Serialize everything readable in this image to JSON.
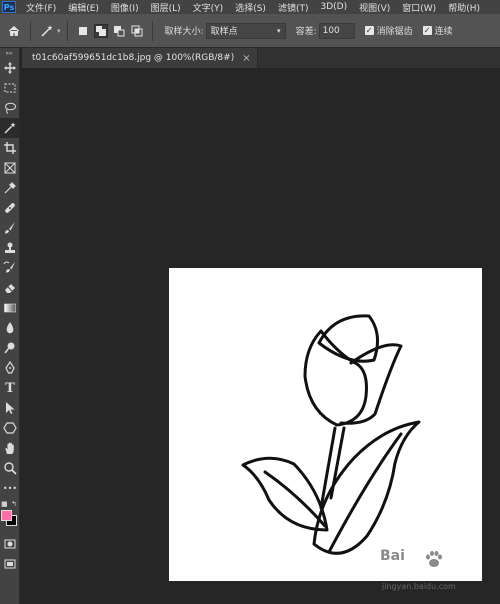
{
  "app": {
    "logo": "Ps"
  },
  "menu": [
    "文件(F)",
    "编辑(E)",
    "图像(I)",
    "图层(L)",
    "文字(Y)",
    "选择(S)",
    "滤镜(T)",
    "3D(D)",
    "视图(V)",
    "窗口(W)",
    "帮助(H)"
  ],
  "options": {
    "sample_size_label": "取样大小:",
    "sample_size_value": "取样点",
    "tolerance_label": "容差:",
    "tolerance_value": "100",
    "antialias_label": "消除锯齿",
    "contiguous_label": "连续",
    "antialias_checked": true,
    "contiguous_checked": true
  },
  "document": {
    "tab_title": "t01c60af599651dc1b8.jpg @ 100%(RGB/8#)",
    "close_glyph": "×"
  },
  "colors": {
    "foreground": "#ff6ea6",
    "background": "#000000"
  },
  "tools": [
    "move-tool",
    "marquee-tool",
    "lasso-tool",
    "magic-wand-tool",
    "crop-tool",
    "frame-tool",
    "eyedropper-tool",
    "healing-brush-tool",
    "brush-tool",
    "clone-stamp-tool",
    "history-brush-tool",
    "eraser-tool",
    "gradient-tool",
    "blur-tool",
    "dodge-tool",
    "pen-tool",
    "type-tool",
    "path-selection-tool",
    "shape-tool",
    "hand-tool",
    "zoom-tool",
    "more-tools"
  ],
  "type_tool_glyph": "T",
  "more_tools_glyph": "•••",
  "watermark": {
    "logo": "Bai",
    "url": "jingyan.baidu.com"
  }
}
